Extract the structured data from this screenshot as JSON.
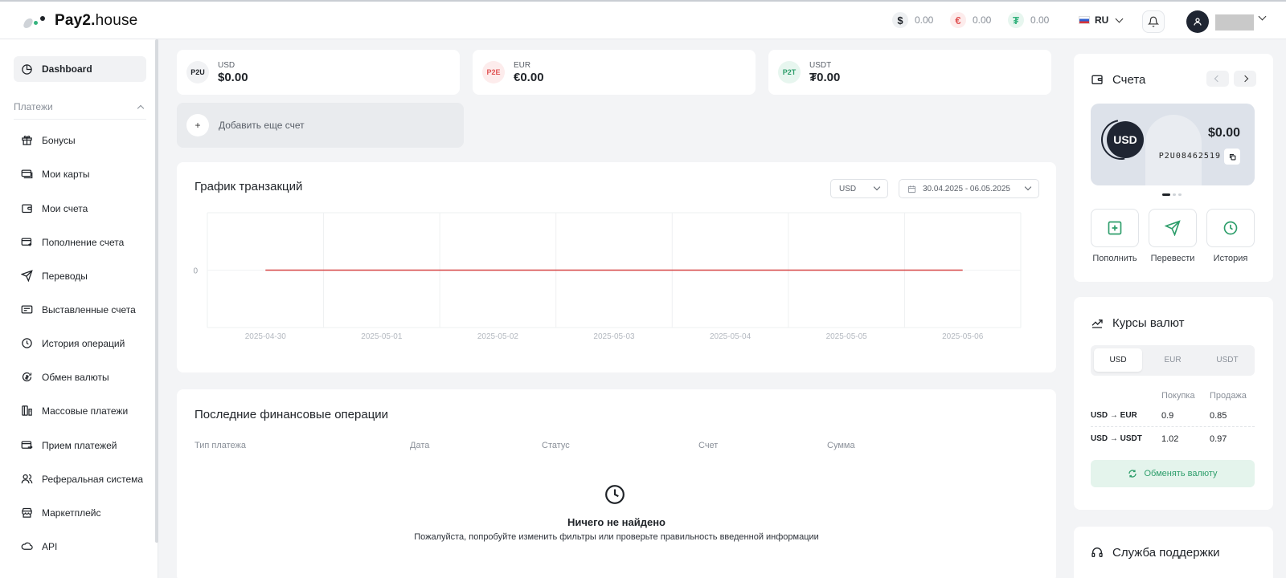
{
  "header": {
    "logo_brand": "Pay2.",
    "logo_suffix": "house",
    "balances": [
      {
        "symbol": "$",
        "value": "0.00"
      },
      {
        "symbol": "€",
        "value": "0.00"
      },
      {
        "symbol": "₮",
        "value": "0.00"
      }
    ],
    "language": "RU"
  },
  "sidebar": {
    "dashboard": "Dashboard",
    "group_label": "Платежи",
    "items": [
      {
        "label": "Бонусы",
        "icon": "gift-icon"
      },
      {
        "label": "Мои карты",
        "icon": "card-icon"
      },
      {
        "label": "Мои счета",
        "icon": "wallet-icon"
      },
      {
        "label": "Пополнение счета",
        "icon": "topup-card-icon"
      },
      {
        "label": "Переводы",
        "icon": "send-icon"
      },
      {
        "label": "Выставленные счета",
        "icon": "invoice-icon"
      },
      {
        "label": "История операций",
        "icon": "clock-icon"
      },
      {
        "label": "Обмен валюты",
        "icon": "exchange-icon"
      },
      {
        "label": "Массовые платежи",
        "icon": "mass-pay-icon"
      },
      {
        "label": "Прием платежей",
        "icon": "receive-icon"
      },
      {
        "label": "Реферальная система",
        "icon": "users-icon"
      },
      {
        "label": "Маркетплейс",
        "icon": "market-icon"
      },
      {
        "label": "API",
        "icon": "cloud-icon"
      }
    ]
  },
  "accounts": [
    {
      "badge": "P2U",
      "code": "USD",
      "amount": "$0.00",
      "badge_bg": "#f1f2f4",
      "badge_color": "#1f2328"
    },
    {
      "badge": "P2E",
      "code": "EUR",
      "amount": "€0.00",
      "badge_bg": "#fdecec",
      "badge_color": "#e05353"
    },
    {
      "badge": "P2T",
      "code": "USDT",
      "amount": "₮0.00",
      "badge_bg": "#e7f6ef",
      "badge_color": "#2e9e6b"
    }
  ],
  "add_account": "Добавить еще счет",
  "transactions_chart": {
    "title": "График транзакций",
    "currency_select": "USD",
    "date_range": "30.04.2025 - 06.05.2025"
  },
  "chart_data": {
    "type": "line",
    "title": "",
    "xlabel": "",
    "ylabel": "",
    "x": [
      "2025-04-30",
      "2025-05-01",
      "2025-05-02",
      "2025-05-03",
      "2025-05-04",
      "2025-05-05",
      "2025-05-06"
    ],
    "y_ticks": [
      "0"
    ],
    "series": [
      {
        "values": [
          0,
          0,
          0,
          0,
          0,
          0,
          0
        ],
        "color": "#d64545"
      }
    ],
    "grid": true
  },
  "operations": {
    "title": "Последние финансовые операции",
    "columns": [
      "Тип платежа",
      "Дата",
      "Статус",
      "Счет",
      "Сумма"
    ],
    "empty_title": "Ничего не найдено",
    "empty_text": "Пожалуйста, попробуйте изменить фильтры или проверьте правильность введенной информации"
  },
  "accounts_panel": {
    "title": "Счета",
    "currency": "USD",
    "balance": "$0.00",
    "account_number": "P2U08462519",
    "actions": [
      "Пополнить",
      "Перевести",
      "История"
    ]
  },
  "rates": {
    "title": "Курсы валют",
    "tabs": [
      "USD",
      "EUR",
      "USDT"
    ],
    "active_tab": "USD",
    "buy_label": "Покупка",
    "sell_label": "Продажа",
    "rows": [
      {
        "pair": "USD → EUR",
        "buy": "0.9",
        "sell": "0.85"
      },
      {
        "pair": "USD → USDT",
        "buy": "1.02",
        "sell": "0.97"
      }
    ],
    "exchange_button": "Обменять валюту"
  },
  "support": {
    "title": "Служба поддержки"
  },
  "colors": {
    "accent": "#35b37e",
    "line": "#d64545",
    "dark": "#1f2532"
  }
}
